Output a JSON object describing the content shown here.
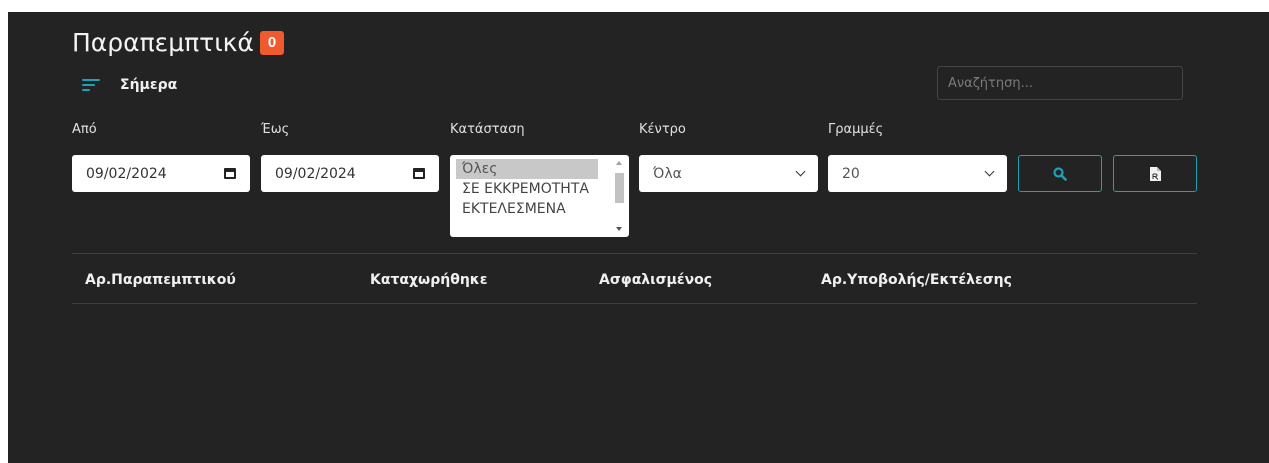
{
  "header": {
    "title": "Παραπεμπτικά",
    "badge": "0"
  },
  "filter_bar": {
    "icon": "filter-list-icon",
    "label": "Σήμερα"
  },
  "search": {
    "placeholder": "Αναζήτηση..."
  },
  "form": {
    "from_label": "Από",
    "from_value": "09/02/2024",
    "to_label": "Έως",
    "to_value": "09/02/2024",
    "status_label": "Κατάσταση",
    "status_options": [
      "Όλες",
      "ΣΕ ΕΚΚΡΕΜΟΤΗΤΑ",
      "ΕΚΤΕΛΕΣΜΕΝΑ"
    ],
    "status_selected": "Όλες",
    "center_label": "Κέντρο",
    "center_value": "Όλα",
    "rows_label": "Γραμμές",
    "rows_value": "20"
  },
  "buttons": {
    "search_icon": "search-icon",
    "export_icon": "prescription-file-icon"
  },
  "table": {
    "columns": [
      "Αρ.Παραπεμπτικού",
      "Καταχωρήθηκε",
      "Ασφαλισμένος",
      "Αρ.Υποβολής/Εκτέλεσης"
    ],
    "rows": []
  },
  "colors": {
    "background": "#232323",
    "accent": "#1fa1b5",
    "badge": "#ef5a2e"
  }
}
